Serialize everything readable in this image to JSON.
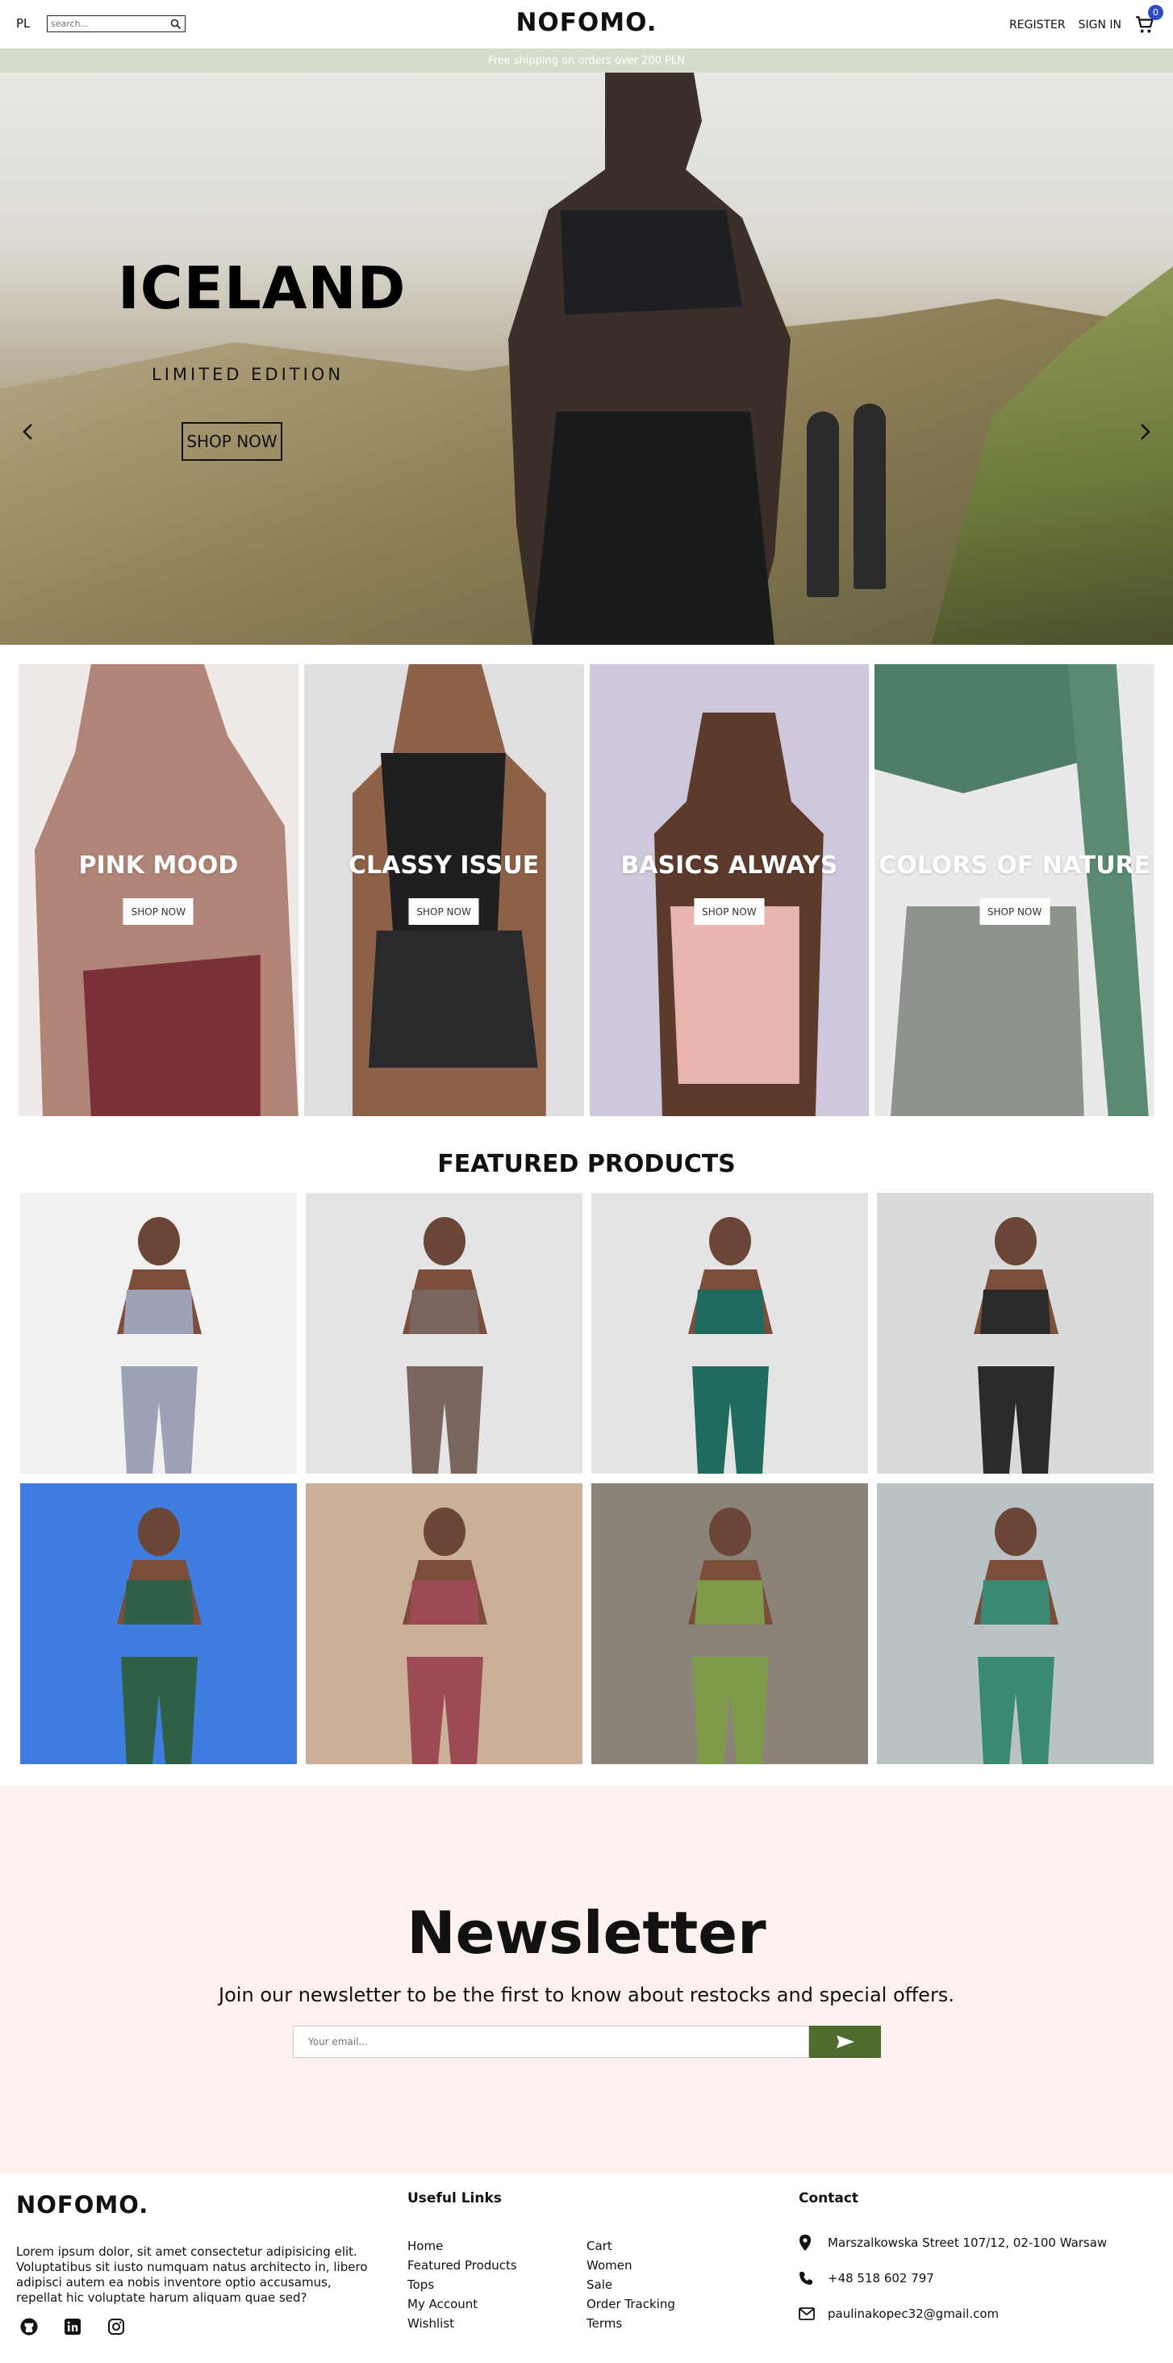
{
  "header": {
    "lang": "PL",
    "search_placeholder": "search...",
    "logo": "NOFOMO.",
    "register": "REGISTER",
    "sign_in": "SIGN IN",
    "cart_count": "0"
  },
  "shipping_bar": "Free shipping on orders over 200 PLN",
  "hero": {
    "title": "ICELAND",
    "subtitle": "LIMITED EDITION",
    "cta": "SHOP NOW"
  },
  "categories": [
    {
      "title": "PINK MOOD",
      "cta": "SHOP NOW",
      "bg": "#b48b7f"
    },
    {
      "title": "CLASSY ISSUE",
      "cta": "SHOP NOW",
      "bg": "#d5d5d6"
    },
    {
      "title": "BASICS ALWAYS",
      "cta": "SHOP NOW",
      "bg": "#c9c1d6"
    },
    {
      "title": "COLORS OF NATURE",
      "cta": "SHOP NOW",
      "bg": "#6b8f7a"
    }
  ],
  "featured": {
    "title": "FEATURED PRODUCTS",
    "products": [
      {
        "color": "#9da2b8",
        "bg": "#f1f1f1"
      },
      {
        "color": "#7a665f",
        "bg": "#e4e4e6"
      },
      {
        "color": "#1f6b5e",
        "bg": "#e4e4e6"
      },
      {
        "color": "#2a2a2a",
        "bg": "#d9dadc"
      },
      {
        "color": "#2f5f45",
        "bg": "#3f7ee0"
      },
      {
        "color": "#9b4a56",
        "bg": "#cbb099"
      },
      {
        "color": "#7f9a4b",
        "bg": "#8b8379"
      },
      {
        "color": "#3a8a73",
        "bg": "#b9c3c6"
      }
    ]
  },
  "newsletter": {
    "title": "Newsletter",
    "text": "Join our newsletter to be the first to know about restocks and special offers.",
    "placeholder": "Your email..."
  },
  "footer": {
    "logo": "NOFOMO.",
    "description": "Lorem ipsum dolor, sit amet consectetur adipisicing elit. Voluptatibus sit iusto numquam natus architecto in, libero adipisci autem ea nobis inventore optio accusamus, repellat hic voluptate harum aliquam quae sed?",
    "useful_links_title": "Useful Links",
    "links_col1": [
      "Home",
      "Featured Products",
      "Tops",
      "My Account",
      "Wishlist"
    ],
    "links_col2": [
      "Cart",
      "Women",
      "Sale",
      "Order Tracking",
      "Terms"
    ],
    "contact_title": "Contact",
    "address": "Marszalkowska Street 107/12, 02-100 Warsaw",
    "phone": "+48 518 602 797",
    "email": "paulinakopec32@gmail.com"
  }
}
